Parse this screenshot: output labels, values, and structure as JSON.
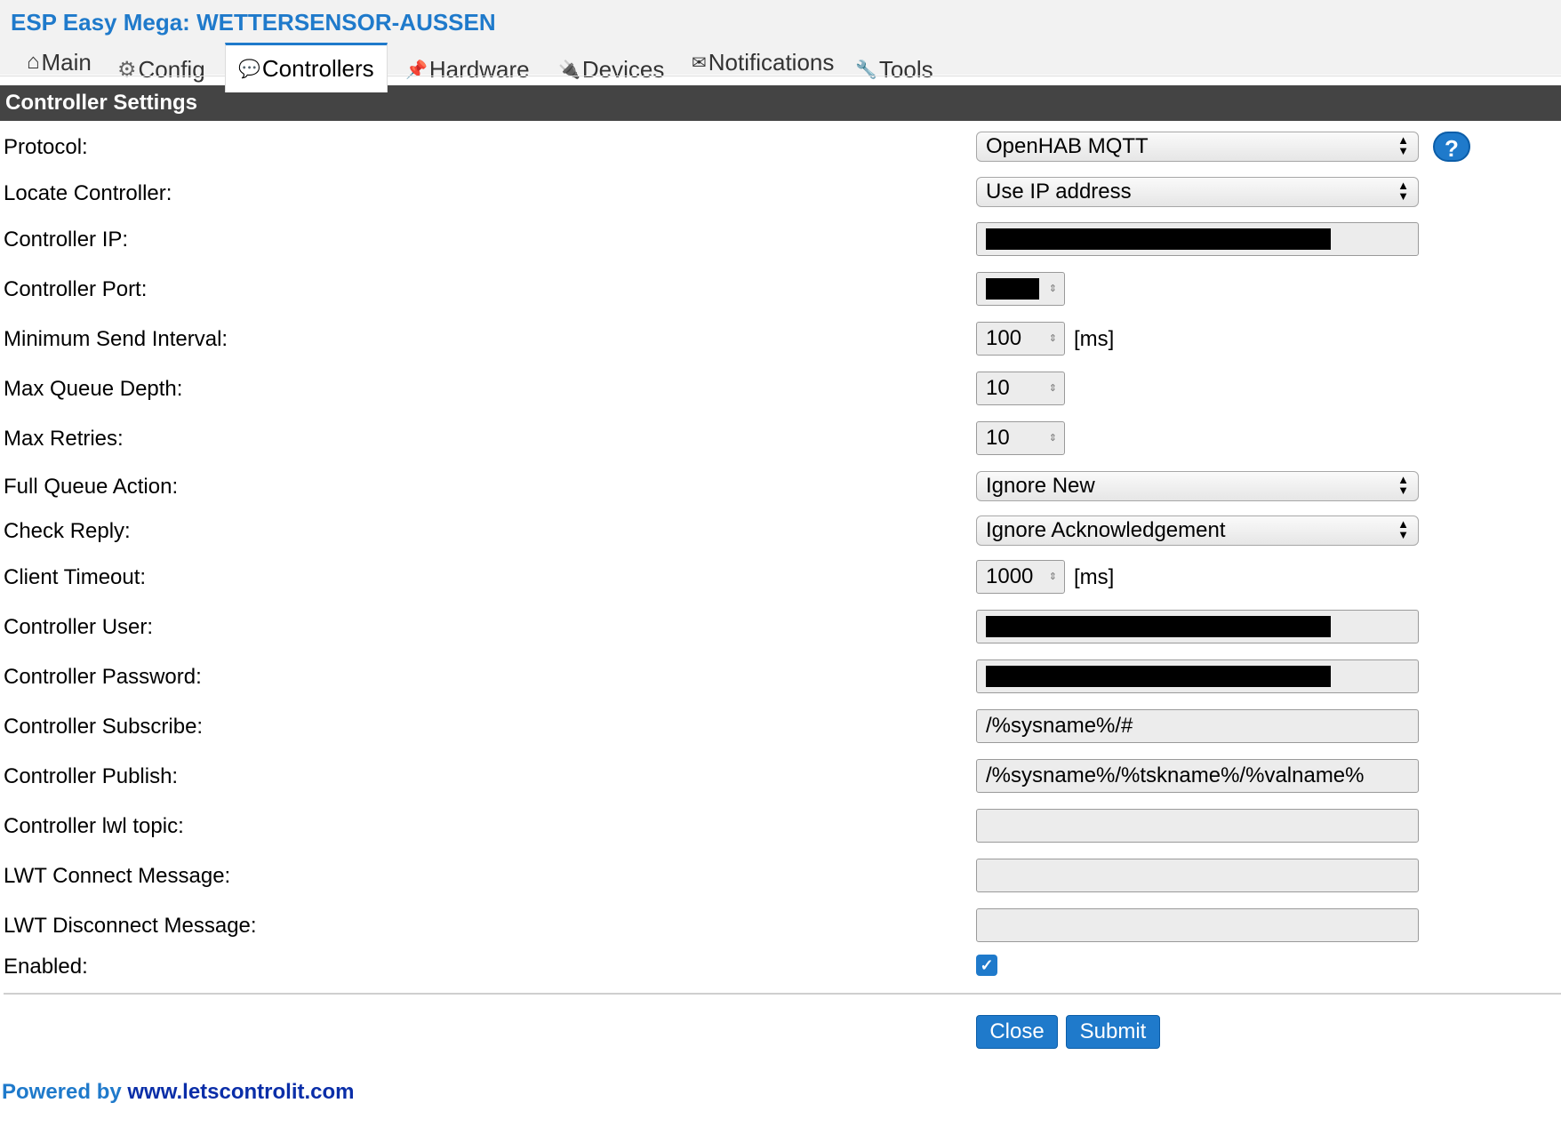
{
  "app_title": "ESP Easy Mega: WETTERSENSOR-AUSSEN",
  "tabs": [
    {
      "label": "Main",
      "icon": "home-icon",
      "glyph": "⌂"
    },
    {
      "label": "Config",
      "icon": "gear-icon",
      "glyph": "⚙"
    },
    {
      "label": "Controllers",
      "icon": "speech-bubble-icon",
      "glyph": "💬"
    },
    {
      "label": "Hardware",
      "icon": "pushpin-icon",
      "glyph": "📌"
    },
    {
      "label": "Devices",
      "icon": "plug-icon",
      "glyph": "🔌"
    },
    {
      "label": "Notifications",
      "icon": "envelope-icon",
      "glyph": "✉"
    },
    {
      "label": "Tools",
      "icon": "wrench-icon",
      "glyph": "🔧"
    }
  ],
  "active_tab": "Controllers",
  "section_title": "Controller Settings",
  "form": {
    "protocol": {
      "label": "Protocol:",
      "value": "OpenHAB MQTT",
      "help": "?"
    },
    "locate_controller": {
      "label": "Locate Controller:",
      "value": "Use IP address"
    },
    "controller_ip": {
      "label": "Controller IP:"
    },
    "controller_port": {
      "label": "Controller Port:"
    },
    "min_send_interval": {
      "label": "Minimum Send Interval:",
      "value": "100",
      "unit": "[ms]"
    },
    "max_queue_depth": {
      "label": "Max Queue Depth:",
      "value": "10"
    },
    "max_retries": {
      "label": "Max Retries:",
      "value": "10"
    },
    "full_queue_action": {
      "label": "Full Queue Action:",
      "value": "Ignore New"
    },
    "check_reply": {
      "label": "Check Reply:",
      "value": "Ignore Acknowledgement"
    },
    "client_timeout": {
      "label": "Client Timeout:",
      "value": "1000",
      "unit": "[ms]"
    },
    "controller_user": {
      "label": "Controller User:"
    },
    "controller_password": {
      "label": "Controller Password:"
    },
    "controller_subscribe": {
      "label": "Controller Subscribe:",
      "value": "/%sysname%/#"
    },
    "controller_publish": {
      "label": "Controller Publish:",
      "value": "/%sysname%/%tskname%/%valname%"
    },
    "controller_lwl_topic": {
      "label": "Controller lwl topic:",
      "value": ""
    },
    "lwt_connect_message": {
      "label": "LWT Connect Message:",
      "value": ""
    },
    "lwt_disconnect_message": {
      "label": "LWT Disconnect Message:",
      "value": ""
    },
    "enabled": {
      "label": "Enabled:",
      "checked": true
    }
  },
  "buttons": {
    "close": "Close",
    "submit": "Submit"
  },
  "footer": {
    "prefix": "Powered by ",
    "link": "www.letscontrolit.com"
  },
  "colors": {
    "accent": "#1f7acb",
    "section_bar": "#444444",
    "input_bg": "#ececec"
  }
}
